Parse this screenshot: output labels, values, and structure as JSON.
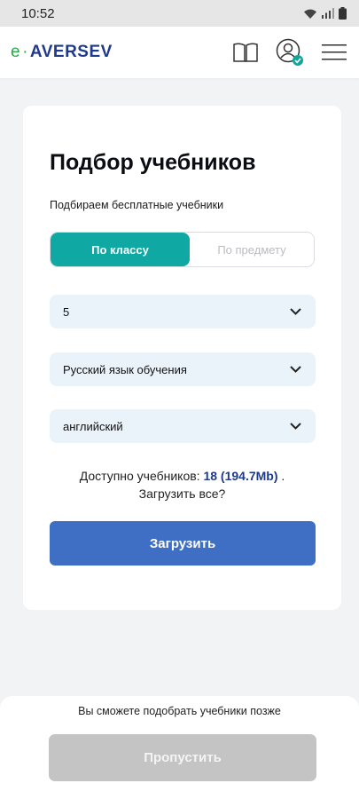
{
  "status_bar": {
    "time": "10:52"
  },
  "header": {
    "logo": {
      "e": "e",
      "dot": "·",
      "rest": "AVERSEV"
    }
  },
  "card": {
    "title": "Подбор учебников",
    "subtitle": "Подбираем бесплатные учебники",
    "tabs": [
      {
        "label": "По классу",
        "active": true
      },
      {
        "label": "По предмету",
        "active": false
      }
    ],
    "selects": [
      {
        "value": "5"
      },
      {
        "value": "Русский язык обучения"
      },
      {
        "value": "английский"
      }
    ],
    "available": {
      "prefix": "Доступно учебников: ",
      "count": "18 (194.7Mb)",
      "suffix": " .",
      "question": "Загрузить все?"
    },
    "download_label": "Загрузить"
  },
  "bottom": {
    "later_text": "Вы сможете подобрать учебники позже",
    "skip_label": "Пропустить"
  },
  "colors": {
    "accent_teal": "#0fa8a3",
    "primary_blue": "#3f6fc4",
    "brand_navy": "#1f3a8a",
    "brand_green": "#2aa84a",
    "select_bg": "#ebf3fa",
    "disabled_gray": "#c4c4c4"
  },
  "icons": {
    "status": [
      "wifi-icon",
      "signal-icon",
      "battery-icon"
    ],
    "header": [
      "book-icon",
      "user-verified-icon",
      "hamburger-menu-icon"
    ],
    "select": "chevron-down-icon"
  }
}
